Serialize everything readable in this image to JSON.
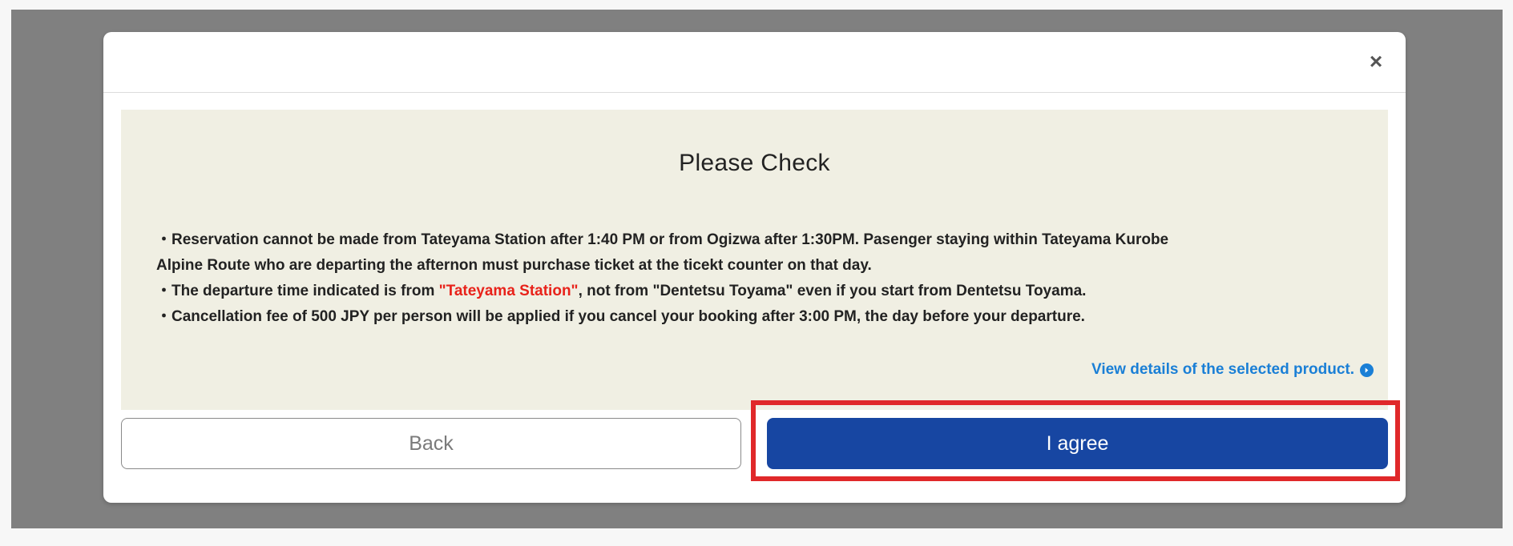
{
  "modal": {
    "close_symbol": "×",
    "title": "Please Check",
    "notes": {
      "line1": "・Reservation cannot be made from Tateyama Station after 1:40 PM or from Ogizwa after 1:30PM. Pasenger staying within Tateyama Kurobe",
      "line2": "Alpine Route who are departing the afternon must purchase ticket at the ticekt counter on that day.",
      "line3_prefix": "・The departure time indicated is from ",
      "line3_highlight": "\"Tateyama Station\"",
      "line3_suffix": ", not from \"Dentetsu Toyama\" even if you start from Dentetsu Toyama.",
      "line4": "・Cancellation fee of 500 JPY per person will be applied if you cancel your booking after 3:00 PM, the day before your departure."
    },
    "details_link": "View details of the selected product.",
    "details_icon": "circle-arrow-right-icon",
    "back_label": "Back",
    "agree_label": "I agree"
  },
  "colors": {
    "overlay": "#808080",
    "panel_bg": "#f0efe3",
    "highlight_text": "#e8221a",
    "link": "#1a7fd6",
    "agree_button": "#1746a2",
    "annotation_box": "#e0282a"
  }
}
